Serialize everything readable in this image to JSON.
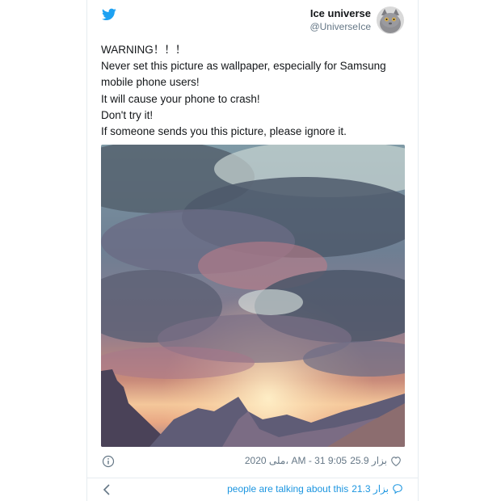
{
  "author": {
    "name": "Ice universe",
    "handle": "@UniverseIce",
    "avatar_icon": "cat-avatar"
  },
  "tweet": {
    "lines": [
      "WARNING！！！",
      "Never set this picture as wallpaper, especially for Samsung",
      "mobile phone users!",
      "It will cause your phone to crash!",
      "Don't try it!",
      "If someone sends you this picture, please ignore it."
    ]
  },
  "footer": {
    "likes": "25.9 بزار",
    "timestamp": "2020 ملى، AM - 31 9:05"
  },
  "bottom_bar": {
    "talking_text": "people are talking about this",
    "talking_count": "21.3 بزار"
  },
  "colors": {
    "link": "#1b95e0",
    "twitter_blue": "#1da1f2",
    "muted": "#657786"
  }
}
